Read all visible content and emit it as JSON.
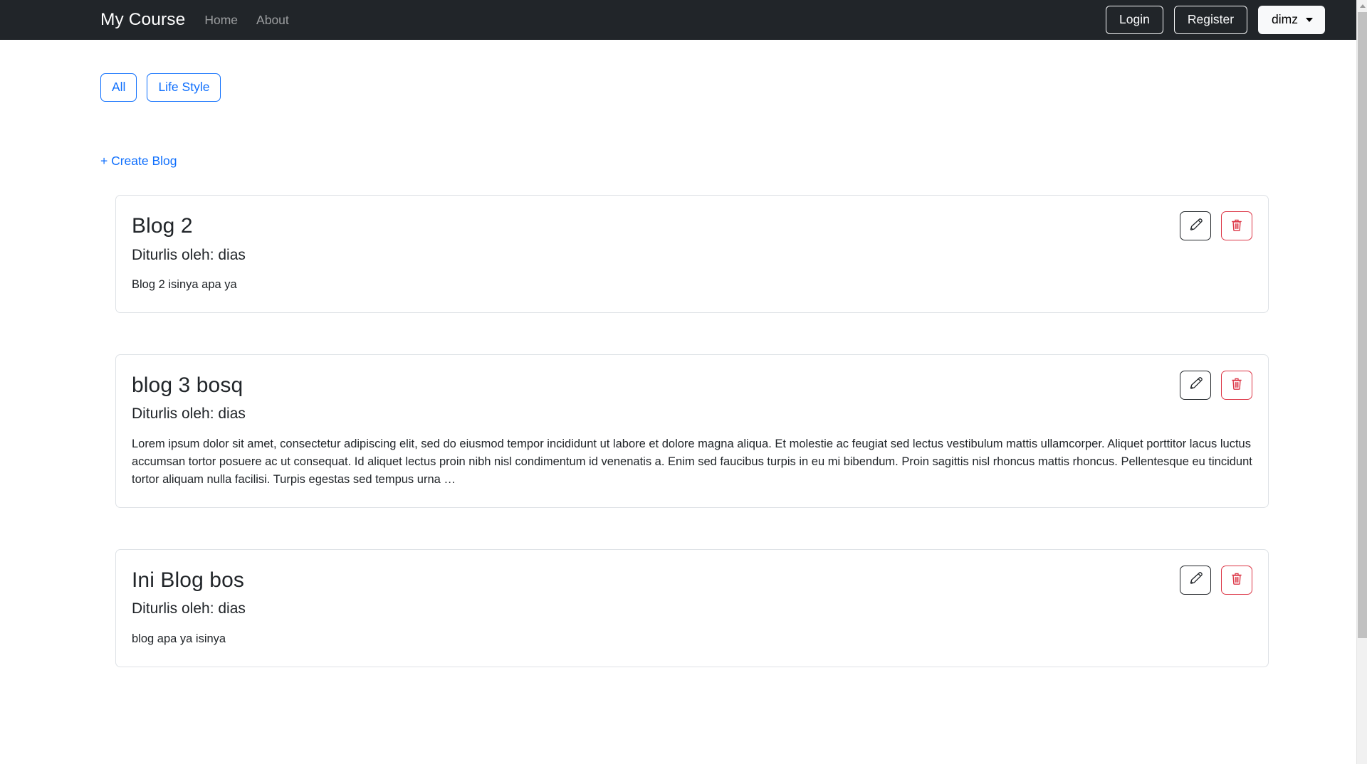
{
  "navbar": {
    "brand": "My Course",
    "links": [
      {
        "label": "Home"
      },
      {
        "label": "About"
      }
    ],
    "login_label": "Login",
    "register_label": "Register",
    "user_label": "dimz",
    "background_color": "#212529",
    "brand_color": "#ffffff",
    "link_color": "rgba(255,255,255,0.55)"
  },
  "filters": {
    "buttons": [
      {
        "label": "All"
      },
      {
        "label": "Life Style"
      }
    ],
    "accent_color": "#0d6efd"
  },
  "actions": {
    "create_blog_label": "+ Create Blog",
    "edit_icon": "pencil-icon",
    "delete_icon": "trash-icon",
    "edit_border_color": "#212529",
    "delete_border_color": "#dc3545"
  },
  "blogs": [
    {
      "title": "Blog 2",
      "author_line": "Diturlis oleh: dias",
      "body": "Blog 2 isinya apa ya"
    },
    {
      "title": "blog 3 bosq",
      "author_line": "Diturlis oleh: dias",
      "body": "Lorem ipsum dolor sit amet, consectetur adipiscing elit, sed do eiusmod tempor incididunt ut labore et dolore magna aliqua. Et molestie ac feugiat sed lectus vestibulum mattis ullamcorper. Aliquet porttitor lacus luctus accumsan tortor posuere ac ut consequat. Id aliquet lectus proin nibh nisl condimentum id venenatis a. Enim sed faucibus turpis in eu mi bibendum. Proin sagittis nisl rhoncus mattis rhoncus. Pellentesque eu tincidunt tortor aliquam nulla facilisi. Turpis egestas sed tempus urna …"
    },
    {
      "title": "Ini Blog bos",
      "author_line": "Diturlis oleh: dias",
      "body": "blog apa ya isinya"
    }
  ]
}
